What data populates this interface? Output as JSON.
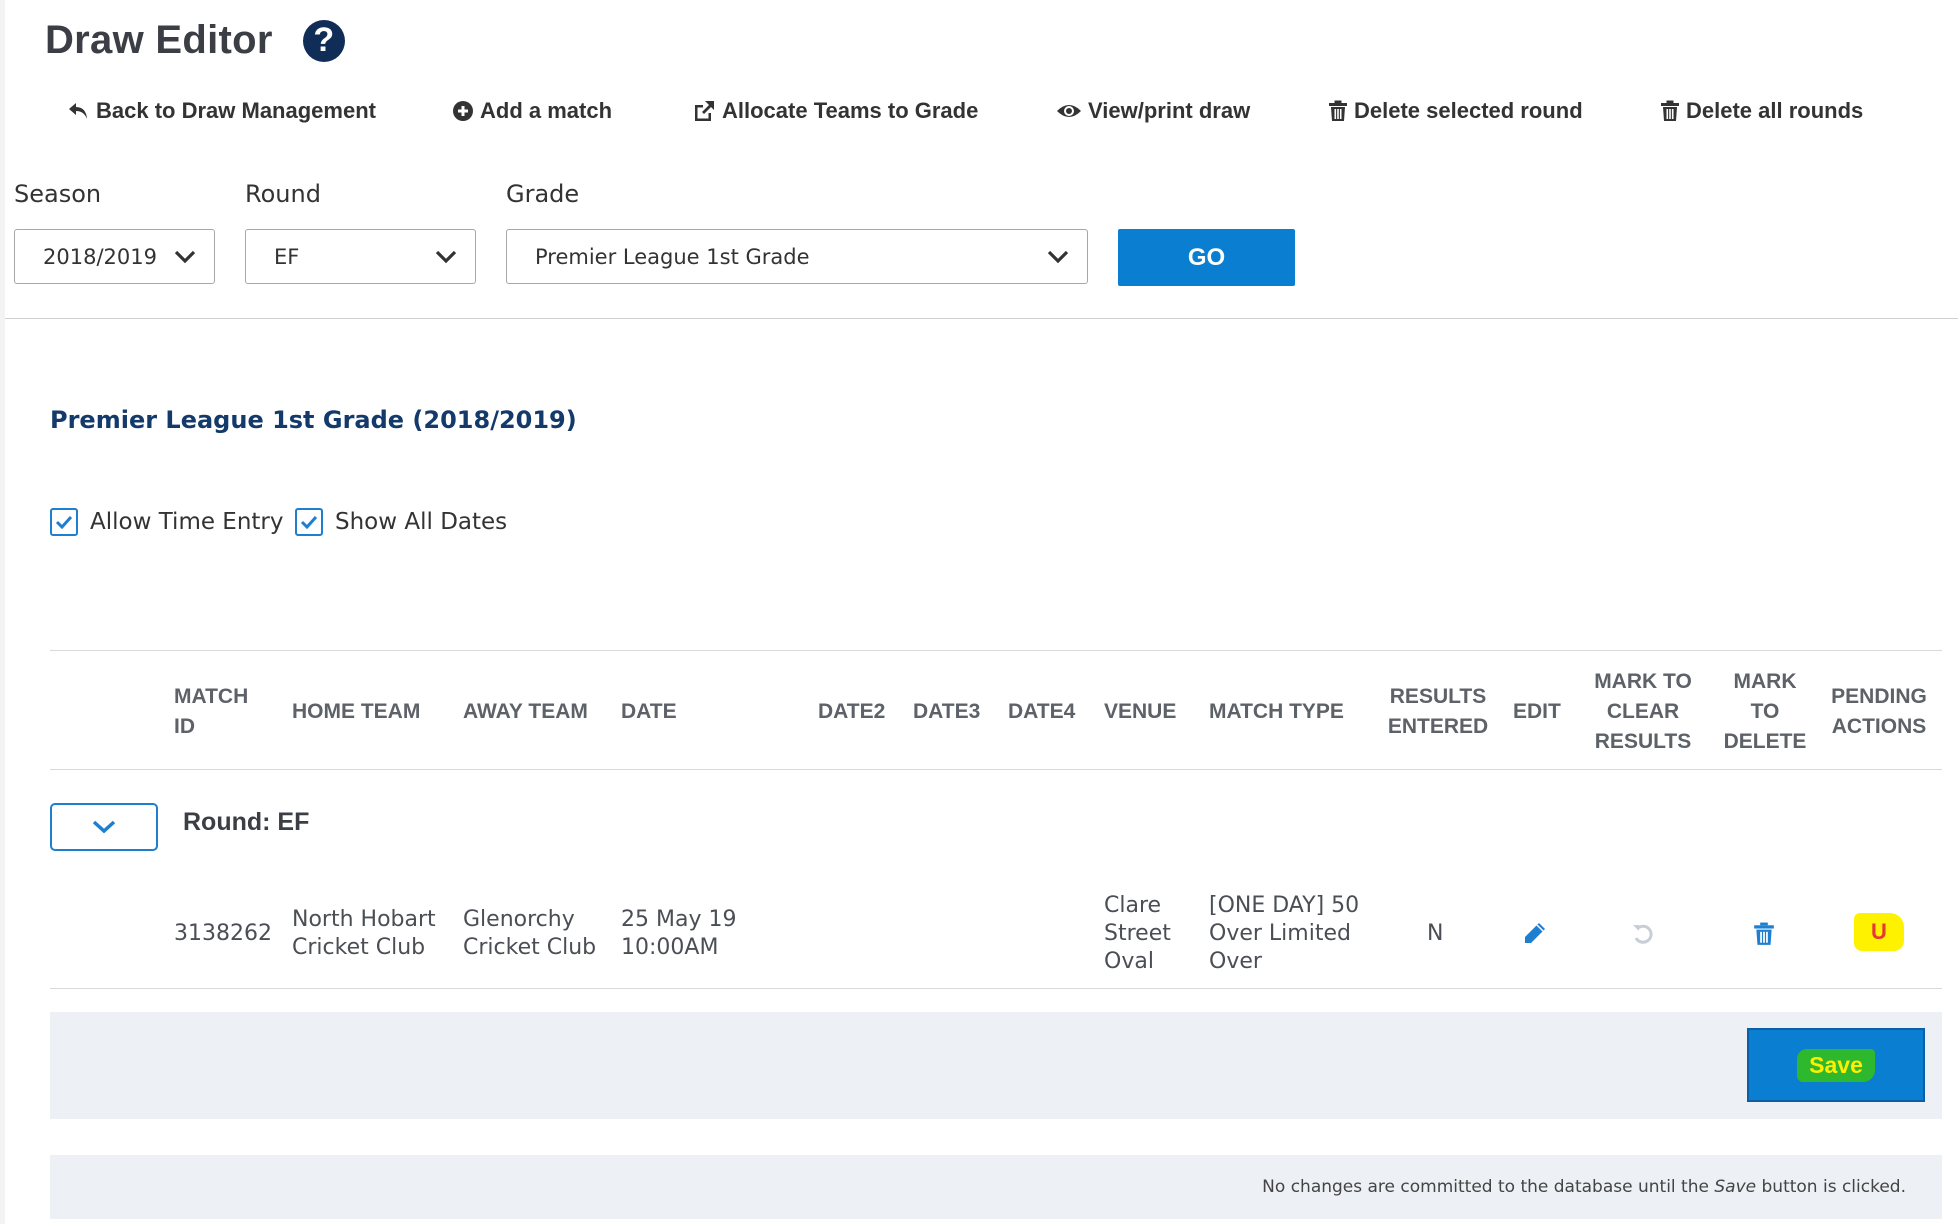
{
  "header": {
    "title": "Draw Editor",
    "help_glyph": "?"
  },
  "toolbar": {
    "back": "Back to Draw Management",
    "add_match": "Add a match",
    "allocate": "Allocate Teams to Grade",
    "view_print": "View/print draw",
    "delete_selected": "Delete selected round",
    "delete_all": "Delete all rounds"
  },
  "filters": {
    "season_label": "Season",
    "season_value": "2018/2019",
    "round_label": "Round",
    "round_value": "EF",
    "grade_label": "Grade",
    "grade_value": "Premier League 1st Grade",
    "go_label": "GO"
  },
  "grade_heading": "Premier League 1st Grade (2018/2019)",
  "options": {
    "allow_time_entry": "Allow Time Entry",
    "show_all_dates": "Show All Dates"
  },
  "table": {
    "headers": {
      "match_id": [
        "MATCH",
        "ID"
      ],
      "home_team": "HOME TEAM",
      "away_team": "AWAY TEAM",
      "date": "DATE",
      "date2": "DATE2",
      "date3": "DATE3",
      "date4": "DATE4",
      "venue": "VENUE",
      "match_type": "MATCH TYPE",
      "results_entered": [
        "RESULTS",
        "ENTERED"
      ],
      "edit": "EDIT",
      "mark_clear": [
        "MARK TO",
        "CLEAR",
        "RESULTS"
      ],
      "mark_delete": [
        "MARK",
        "TO",
        "DELETE"
      ],
      "pending": [
        "PENDING",
        "ACTIONS"
      ]
    },
    "round_label": "Round: EF",
    "row": {
      "match_id": "3138262",
      "home_team": [
        "North Hobart",
        "Cricket Club"
      ],
      "away_team": [
        "Glenorchy",
        "Cricket Club"
      ],
      "date": [
        "25 May 19",
        "10:00AM"
      ],
      "venue": [
        "Clare",
        "Street",
        "Oval"
      ],
      "match_type": [
        "[ONE DAY] 50",
        "Over Limited",
        "Over"
      ],
      "results_entered": "N",
      "pending_action": "U"
    }
  },
  "save_label": "Save",
  "footer_note": {
    "before": "No changes are committed to the database until the ",
    "emph": "Save",
    "after": " button is clicked."
  },
  "colors": {
    "accent": "#0a7fd1",
    "heading": "#143a6b",
    "highlight_yellow": "#fff200",
    "highlight_green": "#2eb82e",
    "pending_red": "#e53935"
  }
}
